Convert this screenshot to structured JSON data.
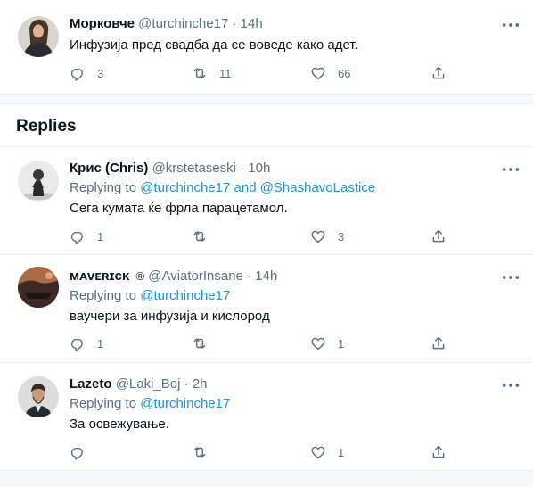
{
  "main_tweet": {
    "name": "Морковче",
    "handle": "@turchinche17",
    "dot": "·",
    "time": "14h",
    "text": "Инфузија пред свадба да се воведе како адет.",
    "reply_count": "3",
    "retweet_count": "11",
    "like_count": "66"
  },
  "replies_heading": "Replies",
  "replies": [
    {
      "name": "Крис (Chris)",
      "handle": "@krstetaseski",
      "dot": "·",
      "time": "10h",
      "replying_prefix": "Replying to",
      "replying_to": "@turchinche17 and @ShashavoLastice",
      "text": "Сега кумата ќе фрла парацетамол.",
      "reply_count": "1",
      "retweet_count": "",
      "like_count": "3"
    },
    {
      "name": "ᴍᴀᴠᴇʀɪᴄᴋ",
      "badge": "®",
      "handle": "@AviatorInsane",
      "dot": "·",
      "time": "14h",
      "replying_prefix": "Replying to",
      "replying_to": "@turchinche17",
      "text": "ваучери за инфузија и кислород",
      "reply_count": "1",
      "retweet_count": "",
      "like_count": "1"
    },
    {
      "name": "Lazeto",
      "handle": "@Laki_Boj",
      "dot": "·",
      "time": "2h",
      "replying_prefix": "Replying to",
      "replying_to": "@turchinche17",
      "text": "За освежување.",
      "reply_count": "",
      "retweet_count": "",
      "like_count": "1"
    }
  ],
  "icons": {
    "reply": "reply-icon",
    "retweet": "retweet-icon",
    "like": "heart-icon",
    "share": "share-icon",
    "more": "more-icon"
  },
  "colors": {
    "link": "#1b95e0",
    "secondary_text": "#5b7083",
    "separator": "#e6ecf0",
    "band": "#f7f9fa"
  }
}
